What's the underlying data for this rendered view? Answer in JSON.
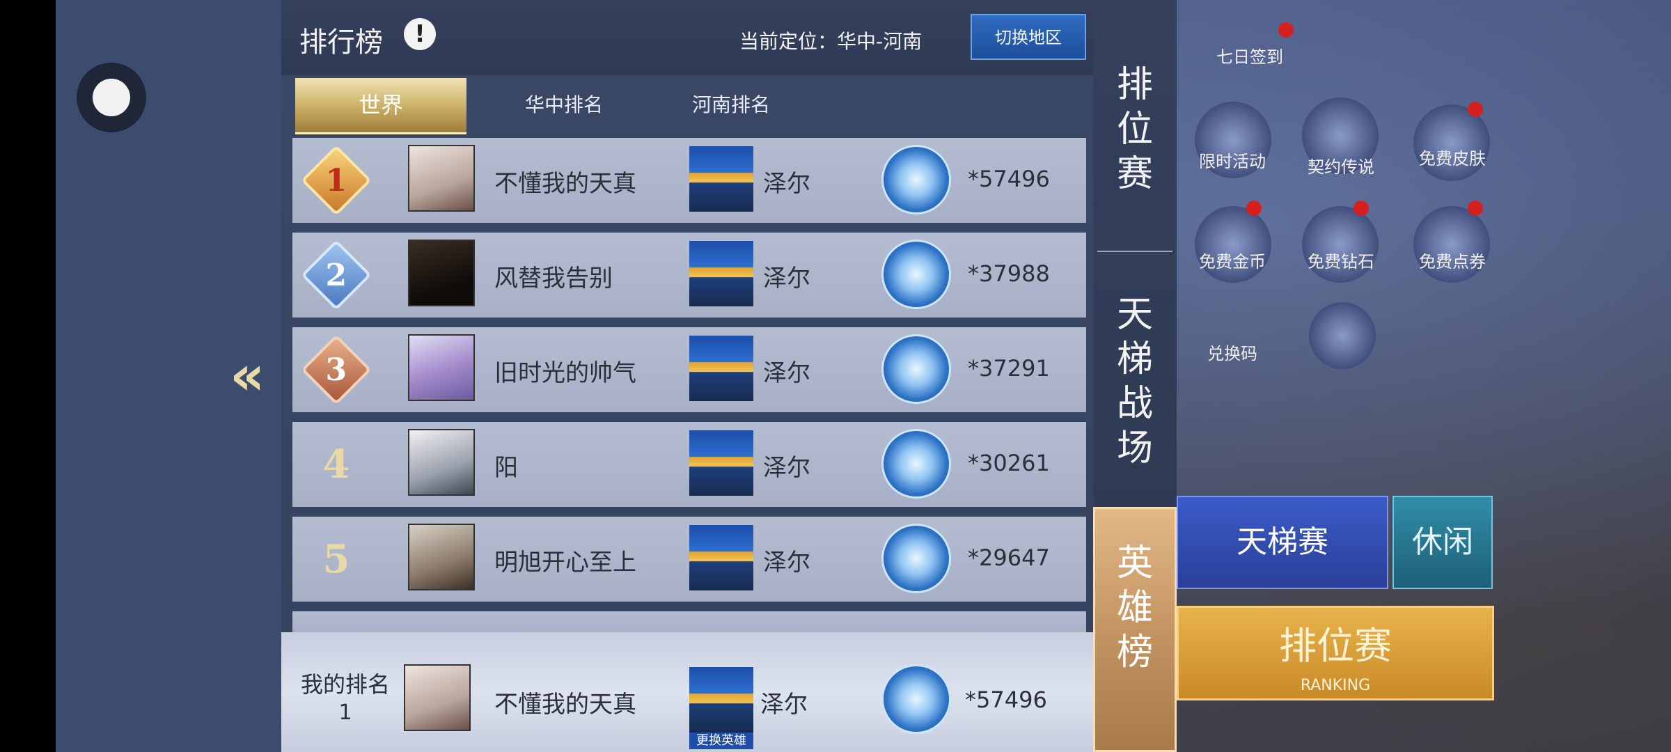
{
  "header": {
    "title": "排行榜",
    "location_label": "当前定位：华中-河南",
    "switch_button": "切换地区"
  },
  "tabs": [
    "世界",
    "华中排名",
    "河南排名"
  ],
  "rows": [
    {
      "rank": "1",
      "name": "不懂我的天真",
      "hero": "泽尔",
      "score": "*57496"
    },
    {
      "rank": "2",
      "name": "风替我告别",
      "hero": "泽尔",
      "score": "*37988"
    },
    {
      "rank": "3",
      "name": "旧时光的帅气",
      "hero": "泽尔",
      "score": "*37291"
    },
    {
      "rank": "4",
      "name": "阳",
      "hero": "泽尔",
      "score": "*30261"
    },
    {
      "rank": "5",
      "name": "明旭开心至上",
      "hero": "泽尔",
      "score": "*29647"
    }
  ],
  "my_rank": {
    "label": "我的排名",
    "rank": "1",
    "name": "不懂我的天真",
    "hero": "泽尔",
    "change_hero": "更换英雄",
    "score": "*57496"
  },
  "side_tabs": [
    "排位赛",
    "天梯战场",
    "英雄榜"
  ],
  "background": {
    "items": [
      "七日签到",
      "限时活动",
      "契约传说",
      "免费皮肤",
      "免费金币",
      "免费钻石",
      "免费点券",
      "兑换码"
    ],
    "peak_button": "天梯赛",
    "leisure_button": "休闲",
    "ranking_button": "排位赛",
    "ranking_sub": "RANKING"
  }
}
